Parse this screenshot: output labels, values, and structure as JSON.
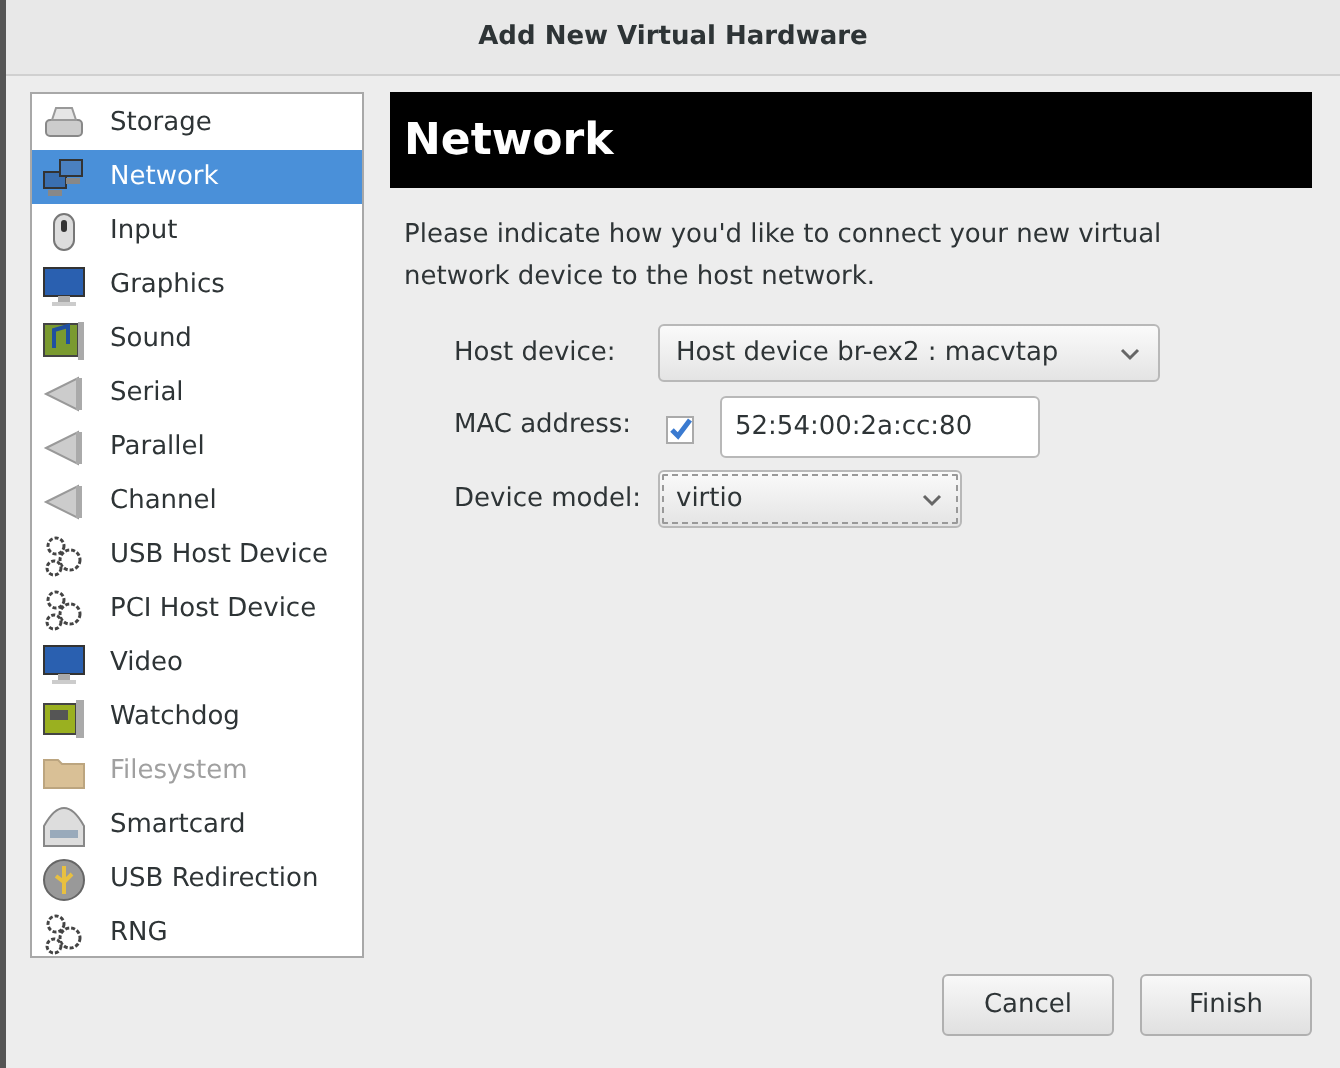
{
  "window": {
    "title": "Add New Virtual Hardware"
  },
  "sidebar": {
    "items": [
      {
        "label": "Storage",
        "kind": "disk",
        "selected": false,
        "disabled": false
      },
      {
        "label": "Network",
        "kind": "network",
        "selected": true,
        "disabled": false
      },
      {
        "label": "Input",
        "kind": "mouse",
        "selected": false,
        "disabled": false
      },
      {
        "label": "Graphics",
        "kind": "monitor",
        "selected": false,
        "disabled": false
      },
      {
        "label": "Sound",
        "kind": "sound",
        "selected": false,
        "disabled": false
      },
      {
        "label": "Serial",
        "kind": "port",
        "selected": false,
        "disabled": false
      },
      {
        "label": "Parallel",
        "kind": "port",
        "selected": false,
        "disabled": false
      },
      {
        "label": "Channel",
        "kind": "port",
        "selected": false,
        "disabled": false
      },
      {
        "label": "USB Host Device",
        "kind": "gears",
        "selected": false,
        "disabled": false
      },
      {
        "label": "PCI Host Device",
        "kind": "gears",
        "selected": false,
        "disabled": false
      },
      {
        "label": "Video",
        "kind": "monitor",
        "selected": false,
        "disabled": false
      },
      {
        "label": "Watchdog",
        "kind": "card",
        "selected": false,
        "disabled": false
      },
      {
        "label": "Filesystem",
        "kind": "folder",
        "selected": false,
        "disabled": true
      },
      {
        "label": "Smartcard",
        "kind": "smartcard",
        "selected": false,
        "disabled": false
      },
      {
        "label": "USB Redirection",
        "kind": "usb",
        "selected": false,
        "disabled": false
      },
      {
        "label": "RNG",
        "kind": "gears",
        "selected": false,
        "disabled": false
      }
    ]
  },
  "panel": {
    "heading": "Network",
    "description": "Please indicate how you'd like to connect your new virtual network device to the host network.",
    "fields": [
      {
        "kind": "select",
        "label": "Host device:",
        "value": "Host device br-ex2 : macvtap",
        "focused": false
      },
      {
        "kind": "checked-input",
        "label": "MAC address:",
        "checked": true,
        "value": "52:54:00:2a:cc:80"
      },
      {
        "kind": "select",
        "label": "Device model:",
        "value": "virtio",
        "focused": true
      }
    ]
  },
  "buttons": [
    "Cancel",
    "Finish"
  ]
}
